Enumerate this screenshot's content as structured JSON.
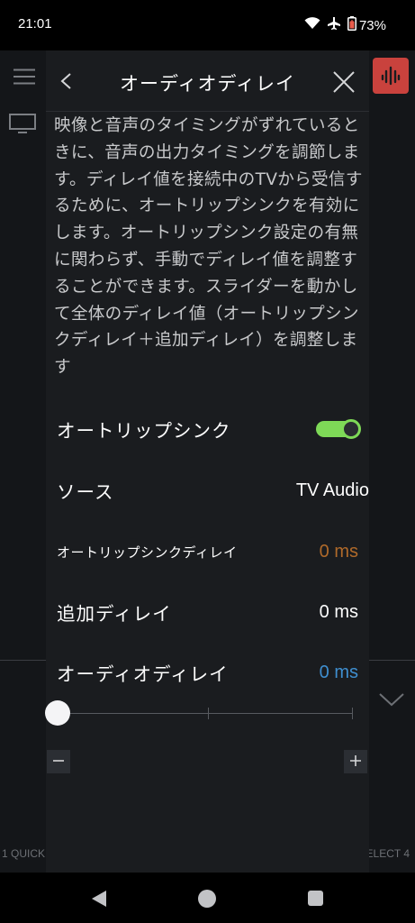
{
  "status_bar": {
    "time": "21:01",
    "battery": "73%",
    "icons": [
      "wifi-icon",
      "airplane-icon",
      "battery-saver-icon"
    ]
  },
  "background": {
    "quick": "1 QUICK",
    "select": "ELECT 4",
    "logo_color": "#c9423d",
    "icons": [
      "menu-icon",
      "tv-icon",
      "chevron-down-icon"
    ]
  },
  "dialog": {
    "title": "オーディオディレイ",
    "description": "映像と音声のタイミングがずれているときに、音声の出力タイミングを調節します。ディレイ値を接続中のTVから受信するために、オートリップシンクを有効にします。オートリップシンク設定の有無に関わらず、手動でディレイ値を調整することができます。スライダーを動かして全体のディレイ値（オートリップシンクディレイ＋追加ディレイ）を調整します",
    "auto_lip_sync": {
      "label": "オートリップシンク",
      "enabled": true
    },
    "source": {
      "label": "ソース",
      "value": "TV Audio"
    },
    "lip_sync_delay": {
      "label": "オートリップシンクディレイ",
      "value": "0 ms",
      "color": "#b06a2a"
    },
    "extra_delay": {
      "label": "追加ディレイ",
      "value": "0 ms"
    },
    "audio_delay": {
      "label": "オーディオディレイ",
      "value": "0 ms",
      "color": "#3f8fd0"
    },
    "slider": {
      "value": 0
    },
    "buttons": {
      "minus": "−",
      "plus": "+"
    }
  },
  "colors": {
    "toggle_on": "#7ed957",
    "dialog_bg": "#1a1c1f"
  }
}
